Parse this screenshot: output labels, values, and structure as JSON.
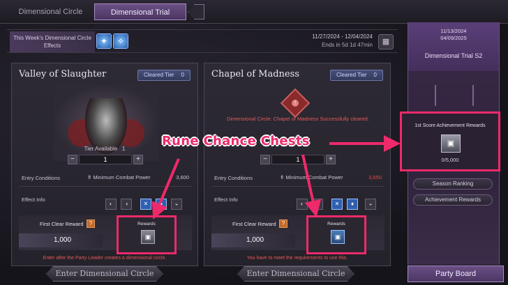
{
  "tabs": [
    {
      "label": "Dimensional Circle",
      "active": false
    },
    {
      "label": "Dimensional Trial",
      "active": true
    }
  ],
  "weekly_effects": {
    "label": "This Week's Dimensional Circle Effects",
    "date_range": "11/27/2024 - 12/04/2024",
    "ends_in": "Ends in 5d 1d 47min",
    "icons": [
      "lightning-orb-icon",
      "frost-orb-icon"
    ]
  },
  "cards": [
    {
      "title": "Valley of Slaughter",
      "cleared_tier_label": "Cleared Tier",
      "cleared_tier_value": "0",
      "tier_available_label": "Tier Available",
      "tier_available_value": "1",
      "stepper_value": "1",
      "entry_conditions_label": "Entry Conditions",
      "entry_requirement": "Minimum Combat Power",
      "entry_requirement_value": "3,600",
      "effect_info_label": "Effect Info",
      "first_clear_label": "First Clear Reward",
      "first_clear_amount": "1,000",
      "rewards_label": "Rewards",
      "warning": "Enter after the Party Leader creates a dimensional circle.",
      "enter_label": "Enter Dimensional Circle"
    },
    {
      "title": "Chapel of Madness",
      "cleared_tier_label": "Cleared Tier",
      "cleared_tier_value": "0",
      "cleared_message": "Dimensional Circle: Chapel of Madness Successfully cleared.",
      "stepper_value": "1",
      "entry_conditions_label": "Entry Conditions",
      "entry_requirement": "Minimum Combat Power",
      "entry_requirement_value": "3,650",
      "effect_info_label": "Effect Info",
      "first_clear_label": "First Clear Reward",
      "first_clear_amount": "1,000",
      "rewards_label": "Rewards",
      "warning": "You have to meet the requirements to use this.",
      "enter_label": "Enter Dimensional Circle"
    }
  ],
  "banner": {
    "date_start": "11/13/2024",
    "date_end": "04/09/2025",
    "title": "Dimensional Trial S2",
    "score_title": "1st Score Achievement Rewards",
    "score_value": "0/5,000",
    "season_ranking": "Season Ranking",
    "achievement_rewards": "Achievement Rewards",
    "party_board": "Party Board"
  },
  "annotation": {
    "label": "Rune Chance Chests",
    "color": "#ee2a6b"
  }
}
